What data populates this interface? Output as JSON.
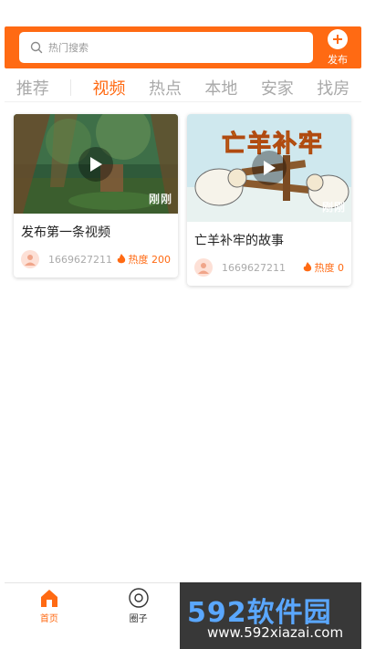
{
  "header": {
    "search_placeholder": "热门搜索",
    "publish_label": "发布",
    "accent": "#ff6a13"
  },
  "tabs": [
    {
      "label": "推荐",
      "active": false
    },
    {
      "label": "视频",
      "active": true
    },
    {
      "label": "热点",
      "active": false
    },
    {
      "label": "本地",
      "active": false
    },
    {
      "label": "安家",
      "active": false
    },
    {
      "label": "找房",
      "active": false
    }
  ],
  "cards": [
    {
      "title": "发布第一条视频",
      "thumb_watermark": "刚刚",
      "user_id": "1669627211",
      "heat_label": "热度 200"
    },
    {
      "title": "亡羊补牢的故事",
      "thumb_watermark": "刚刚",
      "thumb_text": "亡羊补牢",
      "user_id": "1669627211",
      "heat_label": "热度 0"
    }
  ],
  "bottom_nav": [
    {
      "label": "首页",
      "icon": "home-icon",
      "active": true
    },
    {
      "label": "圈子",
      "icon": "disc-icon",
      "active": false
    }
  ],
  "site_watermark": {
    "brand": "592软件园",
    "url": "www.592xiazai.com"
  }
}
